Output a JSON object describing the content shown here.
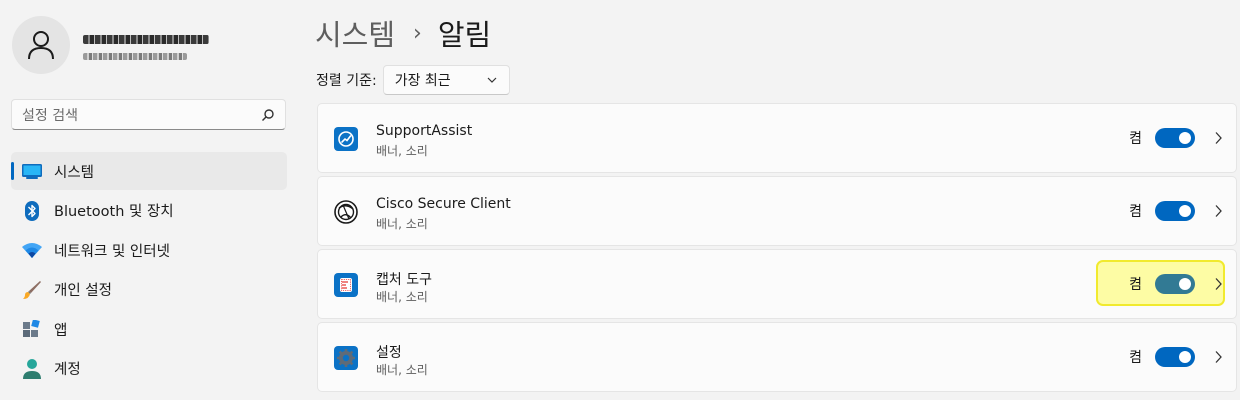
{
  "sidebar": {
    "search": {
      "placeholder": "설정 검색"
    },
    "items": [
      {
        "label": "시스템",
        "icon": "monitor-icon",
        "selected": true
      },
      {
        "label": "Bluetooth 및 장치",
        "icon": "bluetooth-icon",
        "selected": false
      },
      {
        "label": "네트워크 및 인터넷",
        "icon": "wifi-icon",
        "selected": false
      },
      {
        "label": "개인 설정",
        "icon": "brush-icon",
        "selected": false
      },
      {
        "label": "앱",
        "icon": "apps-icon",
        "selected": false
      },
      {
        "label": "계정",
        "icon": "account-icon",
        "selected": false
      }
    ]
  },
  "header": {
    "breadcrumb": {
      "parent": "시스템",
      "separator": "›",
      "current": "알림"
    }
  },
  "sort": {
    "label": "정렬 기준:",
    "value": "가장 최근"
  },
  "apps": [
    {
      "name": "SupportAssist",
      "sub": "배너, 소리",
      "state": "켬",
      "on": true,
      "icon": "supportassist-icon"
    },
    {
      "name": "Cisco Secure Client",
      "sub": "배너, 소리",
      "state": "켬",
      "on": true,
      "icon": "cisco-secure-client-icon"
    },
    {
      "name": "캡처 도구",
      "sub": "배너, 소리",
      "state": "켬",
      "on": true,
      "icon": "snipping-tool-icon"
    },
    {
      "name": "설정",
      "sub": "배너, 소리",
      "state": "켬",
      "on": true,
      "icon": "settings-gear-icon"
    }
  ],
  "colors": {
    "accent": "#0067c0",
    "highlight": "#fdfca4",
    "highlight_border": "#f1ea2e",
    "highlighted_toggle": "#327a94"
  }
}
